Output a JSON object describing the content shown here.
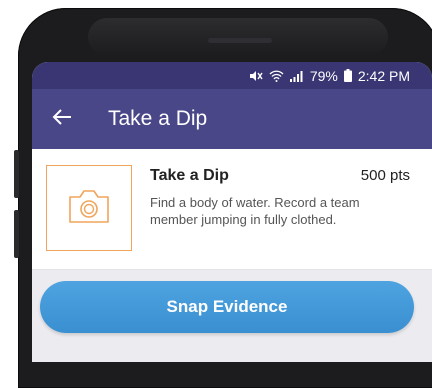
{
  "status_bar": {
    "battery_percent": "79%",
    "time": "2:42 PM",
    "icons": [
      "mute-icon",
      "wifi-icon",
      "signal-icon",
      "battery-icon"
    ]
  },
  "app_bar": {
    "back_icon": "arrow-left-icon",
    "title": "Take a Dip"
  },
  "challenge": {
    "title": "Take a Dip",
    "points": "500 pts",
    "description": "Find a body of water. Record a team member jumping in fully clothed.",
    "thumbnail_icon": "camera-icon"
  },
  "action": {
    "label": "Snap Evidence"
  },
  "colors": {
    "status_bar": "#3a3673",
    "app_bar": "#4a4789",
    "accent_orange": "#f0a55c",
    "button_blue": "#3a8fd1"
  }
}
